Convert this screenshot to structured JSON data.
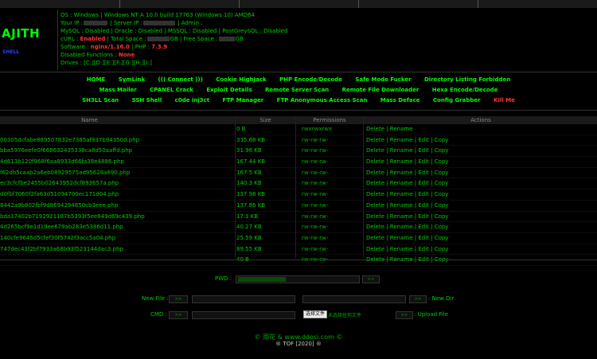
{
  "brand": {
    "title": "AJITH",
    "subtitle": "SHELL"
  },
  "info": {
    "os": "OS : Windows | Windows NT A 10.0 build 17763 (Windows 10) AMD64",
    "your_ip": "Your IP :",
    "server_ip": "| Server IP :",
    "admin": "| Admin :",
    "db": "MySQL : Disabled | Oracle : Disabled | MSSQL : Disabled | PostGreySQL : Disabled",
    "curl_label": "cURL : ",
    "curl_val": "Enabled",
    "total_space": " | Total Space :",
    "gb1": "GB | Free Space :",
    "gb2": "GB",
    "software_label": "Software : ",
    "software_val": "nginx/1.16.0",
    "php_label": " | PHP : ",
    "php_val": "7.3.9",
    "disabled_label": "Disabled Functions : ",
    "disabled_val": "None",
    "drives": "Drives : [C:][D:][E:][F:][G:][H:][I:]"
  },
  "nav": {
    "row1": [
      "HOME",
      "SymLink",
      "((( Connect )))",
      "Cookie HighJack",
      "PHP Encode/Decode",
      "Safe Mode Fucker",
      "Directory Listing Forbidden"
    ],
    "row2": [
      "Mass Mailer",
      "CPANEL Crack",
      "Exploit Details",
      "Remote Server Scan",
      "Remote File Downloader",
      "Hexa Encode/Decode"
    ],
    "row3": [
      "SH3LL Scan",
      "SSH Shell",
      "c0de inj3ct",
      "FTP Manager",
      "FTP Anonymous Access Scan",
      "Mass Deface",
      "Config Grabber"
    ],
    "kill": "Kill Me"
  },
  "table": {
    "headers": [
      "Name",
      "Size",
      "Permissions",
      "Actions"
    ],
    "rows": [
      {
        "name": "",
        "size": "0 B",
        "perm": "rwxrwxrwx",
        "actions": "Delete | Rename"
      },
      {
        "name": "00305dcfabe889507832e7385af937b94350d.php",
        "size": "335.68 KB",
        "perm": "rw-rw-rw-",
        "actions": "Delete | Rename | Edit | Copy"
      },
      {
        "name": "bba5976eefe0f668632435338ca8d50aaffd.php",
        "size": "31.96 KB",
        "perm": "rw-rw-rw-",
        "actions": "Delete | Rename | Edit | Copy"
      },
      {
        "name": "4d613b120f968f6aa8933d66fa38e4886.php",
        "size": "167.44 KB",
        "perm": "rw-rw-rw-",
        "actions": "Delete | Rename | Edit | Copy"
      },
      {
        "name": "f62db5caab2a6eb08929575ad95628a690.php",
        "size": "167.5 KB",
        "perm": "rw-rw-rw-",
        "actions": "Delete | Rename | Edit | Copy"
      },
      {
        "name": "ec3cfcfbe2455b02643952dcf893657a.php",
        "size": "140.3 KB",
        "perm": "rw-rw-rw-",
        "actions": "Delete | Rename | Edit | Copy"
      },
      {
        "name": "d0fbf7060f2fa63d51094700ec171d04.php",
        "size": "137.98 KB",
        "perm": "rw-rw-rw-",
        "actions": "Delete | Rename | Edit | Copy"
      },
      {
        "name": "8442a9b802fbf9d8694294850cb3eee.php",
        "size": "137.86 KB",
        "perm": "rw-rw-rw-",
        "actions": "Delete | Rename | Edit | Copy"
      },
      {
        "name": "bda17402b7192921187b5393f5ee649d69c439.php",
        "size": "17.1 KB",
        "perm": "rw-rw-rw-",
        "actions": "Delete | Rename | Edit | Copy"
      },
      {
        "name": "4d265bcf9e1d19ee679ab283e5386d11.php",
        "size": "40.27 KB",
        "perm": "rw-rw-rw-",
        "actions": "Delete | Rename | Edit | Copy"
      },
      {
        "name": "140cfe9645d5cfef30f5742f3acc5a04.php",
        "size": "25.59 KB",
        "perm": "rw-rw-rw-",
        "actions": "Delete | Rename | Edit | Copy"
      },
      {
        "name": "747dec43f2bf7933a68b93f523144dac3.php",
        "size": "89.55 KB",
        "perm": "rw-rw-rw-",
        "actions": "Delete | Rename | Edit | Copy"
      },
      {
        "name": "",
        "size": "40 B",
        "perm": "rw-rw-rw-",
        "actions": "Delete | Rename | Edit | Copy"
      }
    ]
  },
  "form": {
    "pwd_label": "PWD :",
    "newfile_label": "New File :",
    "newdir_label": ": New Dir",
    "cmd_label": "CMD :",
    "go": ">>",
    "choose_file": "选择文件",
    "no_file": "未选择任何文件",
    "upload_label": ": Upload File"
  },
  "footer": {
    "line1": "© 雨花 & www.ddosi.com ©",
    "line2": "® TOF [2020] ®"
  }
}
